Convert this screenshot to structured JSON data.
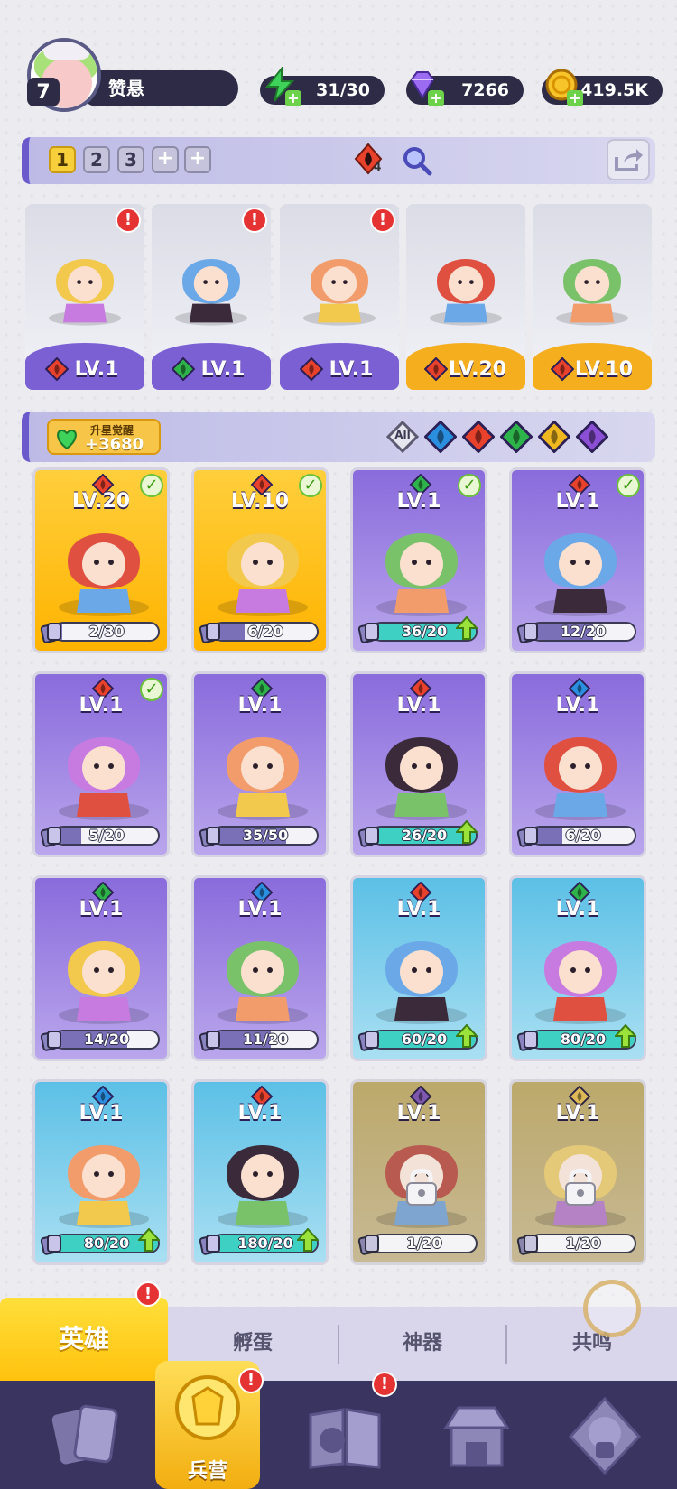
{
  "player": {
    "level": "7",
    "name": "赞悬"
  },
  "resources": {
    "energy": "31/30",
    "gems": "7266",
    "gold": "419.5K"
  },
  "team_bar": {
    "tabs": [
      "1",
      "2",
      "3"
    ],
    "active_tab": "1",
    "fire_count": "4"
  },
  "team": [
    {
      "level": "LV.1",
      "element": "fire",
      "style": "purple"
    },
    {
      "level": "LV.1",
      "element": "wind",
      "style": "purple"
    },
    {
      "level": "LV.1",
      "element": "fire",
      "style": "purple"
    },
    {
      "level": "LV.20",
      "element": "fire",
      "style": "gold"
    },
    {
      "level": "LV.10",
      "element": "fire",
      "style": "gold"
    }
  ],
  "awaken": {
    "label": "升星觉醒",
    "value": "+3680"
  },
  "filters": {
    "all_label": "All",
    "elements": [
      "water",
      "fire",
      "wind",
      "light",
      "dark"
    ]
  },
  "heroes": [
    {
      "level": "LV.20",
      "progress": "2/30",
      "fraction": 0.07,
      "style": "gold",
      "element": "fire",
      "check": true,
      "upgrade": false
    },
    {
      "level": "LV.10",
      "progress": "6/20",
      "fraction": 0.3,
      "style": "gold",
      "element": "fire",
      "check": true,
      "upgrade": false
    },
    {
      "level": "LV.1",
      "progress": "36/20",
      "fraction": 1,
      "style": "purple",
      "element": "wind",
      "check": true,
      "upgrade": true
    },
    {
      "level": "LV.1",
      "progress": "12/20",
      "fraction": 0.6,
      "style": "purple",
      "element": "fire",
      "check": true,
      "upgrade": false
    },
    {
      "level": "LV.1",
      "progress": "5/20",
      "fraction": 0.25,
      "style": "purple",
      "element": "fire",
      "check": true,
      "upgrade": false
    },
    {
      "level": "LV.1",
      "progress": "35/50",
      "fraction": 0.7,
      "style": "purple",
      "element": "wind",
      "check": false,
      "upgrade": false
    },
    {
      "level": "LV.1",
      "progress": "26/20",
      "fraction": 1,
      "style": "purple",
      "element": "fire",
      "check": false,
      "upgrade": true
    },
    {
      "level": "LV.1",
      "progress": "6/20",
      "fraction": 0.3,
      "style": "purple",
      "element": "water",
      "check": false,
      "upgrade": false
    },
    {
      "level": "LV.1",
      "progress": "14/20",
      "fraction": 0.7,
      "style": "purple",
      "element": "wind",
      "check": false,
      "upgrade": false
    },
    {
      "level": "LV.1",
      "progress": "11/20",
      "fraction": 0.55,
      "style": "purple",
      "element": "water",
      "check": false,
      "upgrade": false
    },
    {
      "level": "LV.1",
      "progress": "60/20",
      "fraction": 1,
      "style": "blue",
      "element": "fire",
      "check": false,
      "upgrade": true
    },
    {
      "level": "LV.1",
      "progress": "80/20",
      "fraction": 1,
      "style": "blue",
      "element": "wind",
      "check": false,
      "upgrade": true
    },
    {
      "level": "LV.1",
      "progress": "80/20",
      "fraction": 1,
      "style": "blue",
      "element": "water",
      "check": false,
      "upgrade": true
    },
    {
      "level": "LV.1",
      "progress": "180/20",
      "fraction": 1,
      "style": "blue",
      "element": "fire",
      "check": false,
      "upgrade": true
    },
    {
      "level": "LV.1",
      "progress": "1/20",
      "fraction": 0.05,
      "style": "locked",
      "element": "dark",
      "check": false,
      "upgrade": false,
      "locked": true
    },
    {
      "level": "LV.1",
      "progress": "1/20",
      "fraction": 0.05,
      "style": "locked",
      "element": "light",
      "check": false,
      "upgrade": false,
      "locked": true
    }
  ],
  "subtabs": [
    "英雄",
    "孵蛋",
    "神器",
    "共鸣"
  ],
  "nav": {
    "center_label": "兵营"
  },
  "colors": {
    "fire": "#e8412c",
    "wind": "#2eb34a",
    "water": "#2b8fe0",
    "light": "#f0b820",
    "dark": "#8b4fd6"
  }
}
